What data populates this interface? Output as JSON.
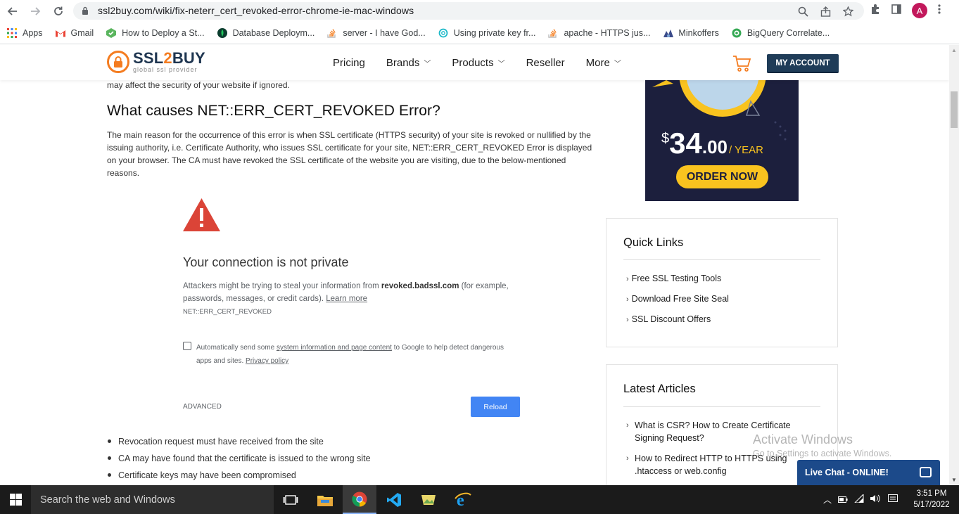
{
  "browser": {
    "url": "ssl2buy.com/wiki/fix-neterr_cert_revoked-error-chrome-ie-mac-windows",
    "profile_initial": "A",
    "bookmarks": [
      {
        "label": "Apps",
        "icon": "apps-grid-icon"
      },
      {
        "label": "Gmail",
        "icon": "gmail-icon"
      },
      {
        "label": "How to Deploy a St...",
        "icon": "deploy-icon"
      },
      {
        "label": "Database Deploym...",
        "icon": "mongodb-leaf-icon"
      },
      {
        "label": "server - I have God...",
        "icon": "stackoverflow-icon"
      },
      {
        "label": "Using private key fr...",
        "icon": "swirl-icon"
      },
      {
        "label": "apache - HTTPS jus...",
        "icon": "stackoverflow-icon"
      },
      {
        "label": "Minkoffers",
        "icon": "minkoffers-icon"
      },
      {
        "label": "BigQuery Correlate...",
        "icon": "bigquery-icon"
      }
    ]
  },
  "site": {
    "logo_main_a": "SSL",
    "logo_main_b": "2",
    "logo_main_c": "BUY",
    "logo_sub": "global ssl provider",
    "nav": [
      "Pricing",
      "Brands",
      "Products",
      "Reseller",
      "More"
    ],
    "my_account": "MY ACCOUNT"
  },
  "article": {
    "lead_tail": "may affect the security of your website if ignored.",
    "heading": "What causes NET::ERR_CERT_REVOKED Error?",
    "paragraph": "The main reason for the occurrence of this error is when SSL certificate (HTTPS security) of your site is revoked or nullified by the issuing authority, i.e. Certificate Authority, who issues SSL certificate for your site, NET::ERR_CERT_REVOKED Error is displayed on your browser. The CA must have revoked the SSL certificate of the website you are visiting, due to the below-mentioned reasons.",
    "error_page": {
      "title": "Your connection is not private",
      "desc_a": "Attackers might be trying to steal your information from ",
      "desc_host": "revoked.badssl.com",
      "desc_b": " (for example, passwords, messages, or credit cards). ",
      "learn_more": "Learn more",
      "code": "NET::ERR_CERT_REVOKED",
      "check_a": "Automatically send some ",
      "check_link": "system information and page content",
      "check_b": " to Google to help detect dangerous apps and sites. ",
      "privacy": "Privacy policy",
      "advanced": "ADVANCED",
      "reload": "Reload"
    },
    "bullets": [
      "Revocation request must have received from the site",
      "CA may have found that the certificate is issued to the wrong site",
      "Certificate keys may have been compromised"
    ]
  },
  "sidebar": {
    "ad": {
      "dollar": "$",
      "price": "34",
      "cents": ".00",
      "per": "/ YEAR",
      "cta": "ORDER NOW"
    },
    "quick_links_title": "Quick Links",
    "quick_links": [
      "Free SSL Testing Tools",
      "Download Free Site Seal",
      "SSL Discount Offers"
    ],
    "latest_title": "Latest Articles",
    "latest": [
      "What is CSR? How to Create Certificate Signing Request?",
      "How to Redirect HTTP to HTTPS using .htaccess or web.config"
    ]
  },
  "overlay": {
    "activate_title": "Activate Windows",
    "activate_sub": "Go to Settings to activate Windows.",
    "live_chat": "Live Chat - ONLINE!"
  },
  "taskbar": {
    "search_placeholder": "Search the web and Windows",
    "time": "3:51 PM",
    "date": "5/17/2022"
  },
  "colors": {
    "brand_orange": "#f47c20",
    "brand_navy": "#1f3c58",
    "reload_blue": "#4285f4",
    "ad_yellow": "#f9c31f",
    "warning_red": "#db4437"
  }
}
